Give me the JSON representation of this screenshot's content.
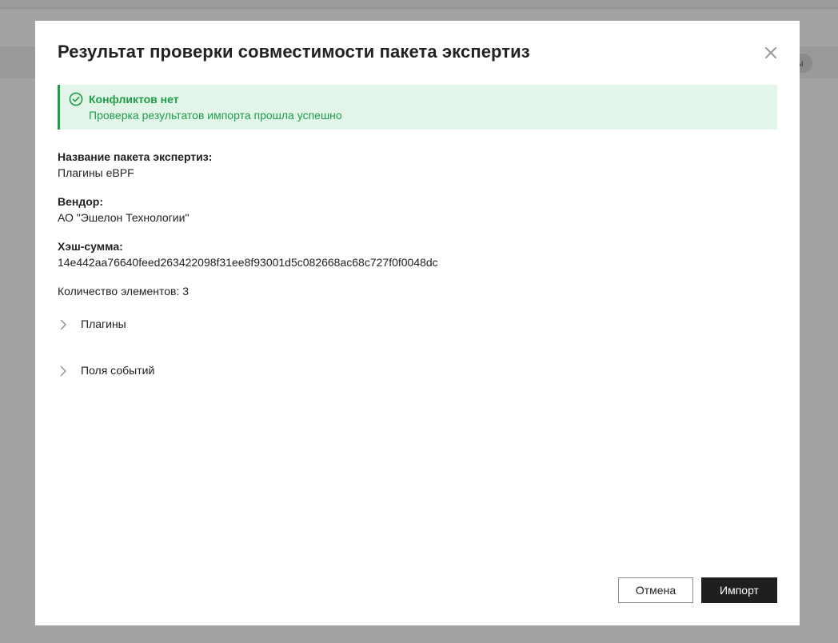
{
  "background": {
    "chip_text": "ы"
  },
  "modal": {
    "title": "Результат проверки совместимости пакета экспертиз",
    "close_icon": "close-icon"
  },
  "alert": {
    "icon": "check-circle-icon",
    "title": "Конфликтов нет",
    "text": "Проверка результатов импорта прошла успешно",
    "color": "#1f9d4a",
    "background": "#e3f5e8"
  },
  "details": {
    "package_name_label": "Название пакета экспертиз:",
    "package_name_value": "Плагины eBPF",
    "vendor_label": "Вендор:",
    "vendor_value": "АО \"Эшелон Технологии\"",
    "hash_label": "Хэш-сумма:",
    "hash_value": "14e442aa76640feed263422098f31ee8f93001d5c082668ac68c727f0f0048dc",
    "count_label": "Количество элементов:",
    "count_value": "3"
  },
  "groups": [
    {
      "label": "Плагины",
      "icon": "chevron-right-icon",
      "expanded": false
    },
    {
      "label": "Поля событий",
      "icon": "chevron-right-icon",
      "expanded": false
    }
  ],
  "footer": {
    "cancel_label": "Отмена",
    "import_label": "Импорт"
  }
}
